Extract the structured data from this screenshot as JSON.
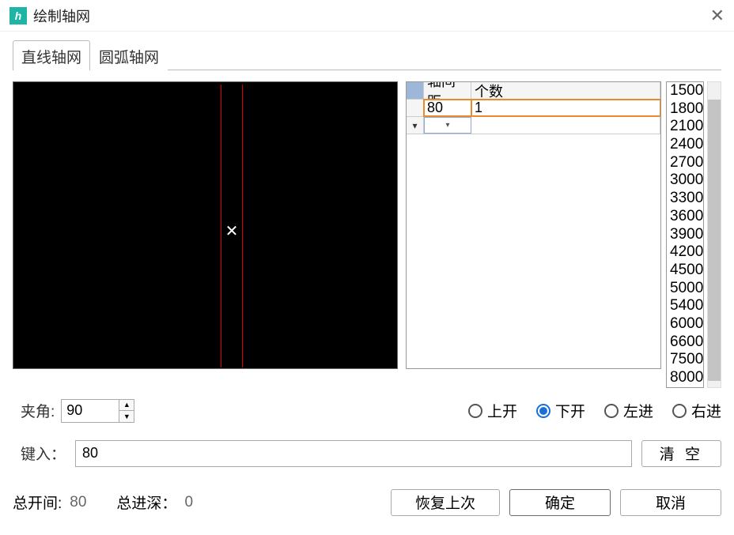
{
  "window": {
    "title": "绘制轴网"
  },
  "tabs": {
    "linear": "直线轴网",
    "arc": "圆弧轴网",
    "active": 0
  },
  "grid": {
    "headers": {
      "spacing": "轴间距",
      "count": "个数"
    },
    "rows": [
      {
        "spacing": "80",
        "count": "1"
      }
    ]
  },
  "presets": [
    "1500",
    "1800",
    "2100",
    "2400",
    "2700",
    "3000",
    "3300",
    "3600",
    "3900",
    "4200",
    "4500",
    "5000",
    "5400",
    "6000",
    "6600",
    "7500",
    "8000"
  ],
  "angle": {
    "label": "夹角:",
    "value": "90"
  },
  "direction": {
    "options": {
      "up": "上开",
      "down": "下开",
      "left": "左进",
      "right": "右进"
    },
    "selected": "down"
  },
  "input": {
    "label": "键入：",
    "value": "80",
    "clear": "清  空"
  },
  "footer": {
    "total_span_label": "总开间:",
    "total_span_value": "80",
    "total_depth_label": "总进深：",
    "total_depth_value": "0",
    "restore": "恢复上次",
    "ok": "确定",
    "cancel": "取消"
  }
}
